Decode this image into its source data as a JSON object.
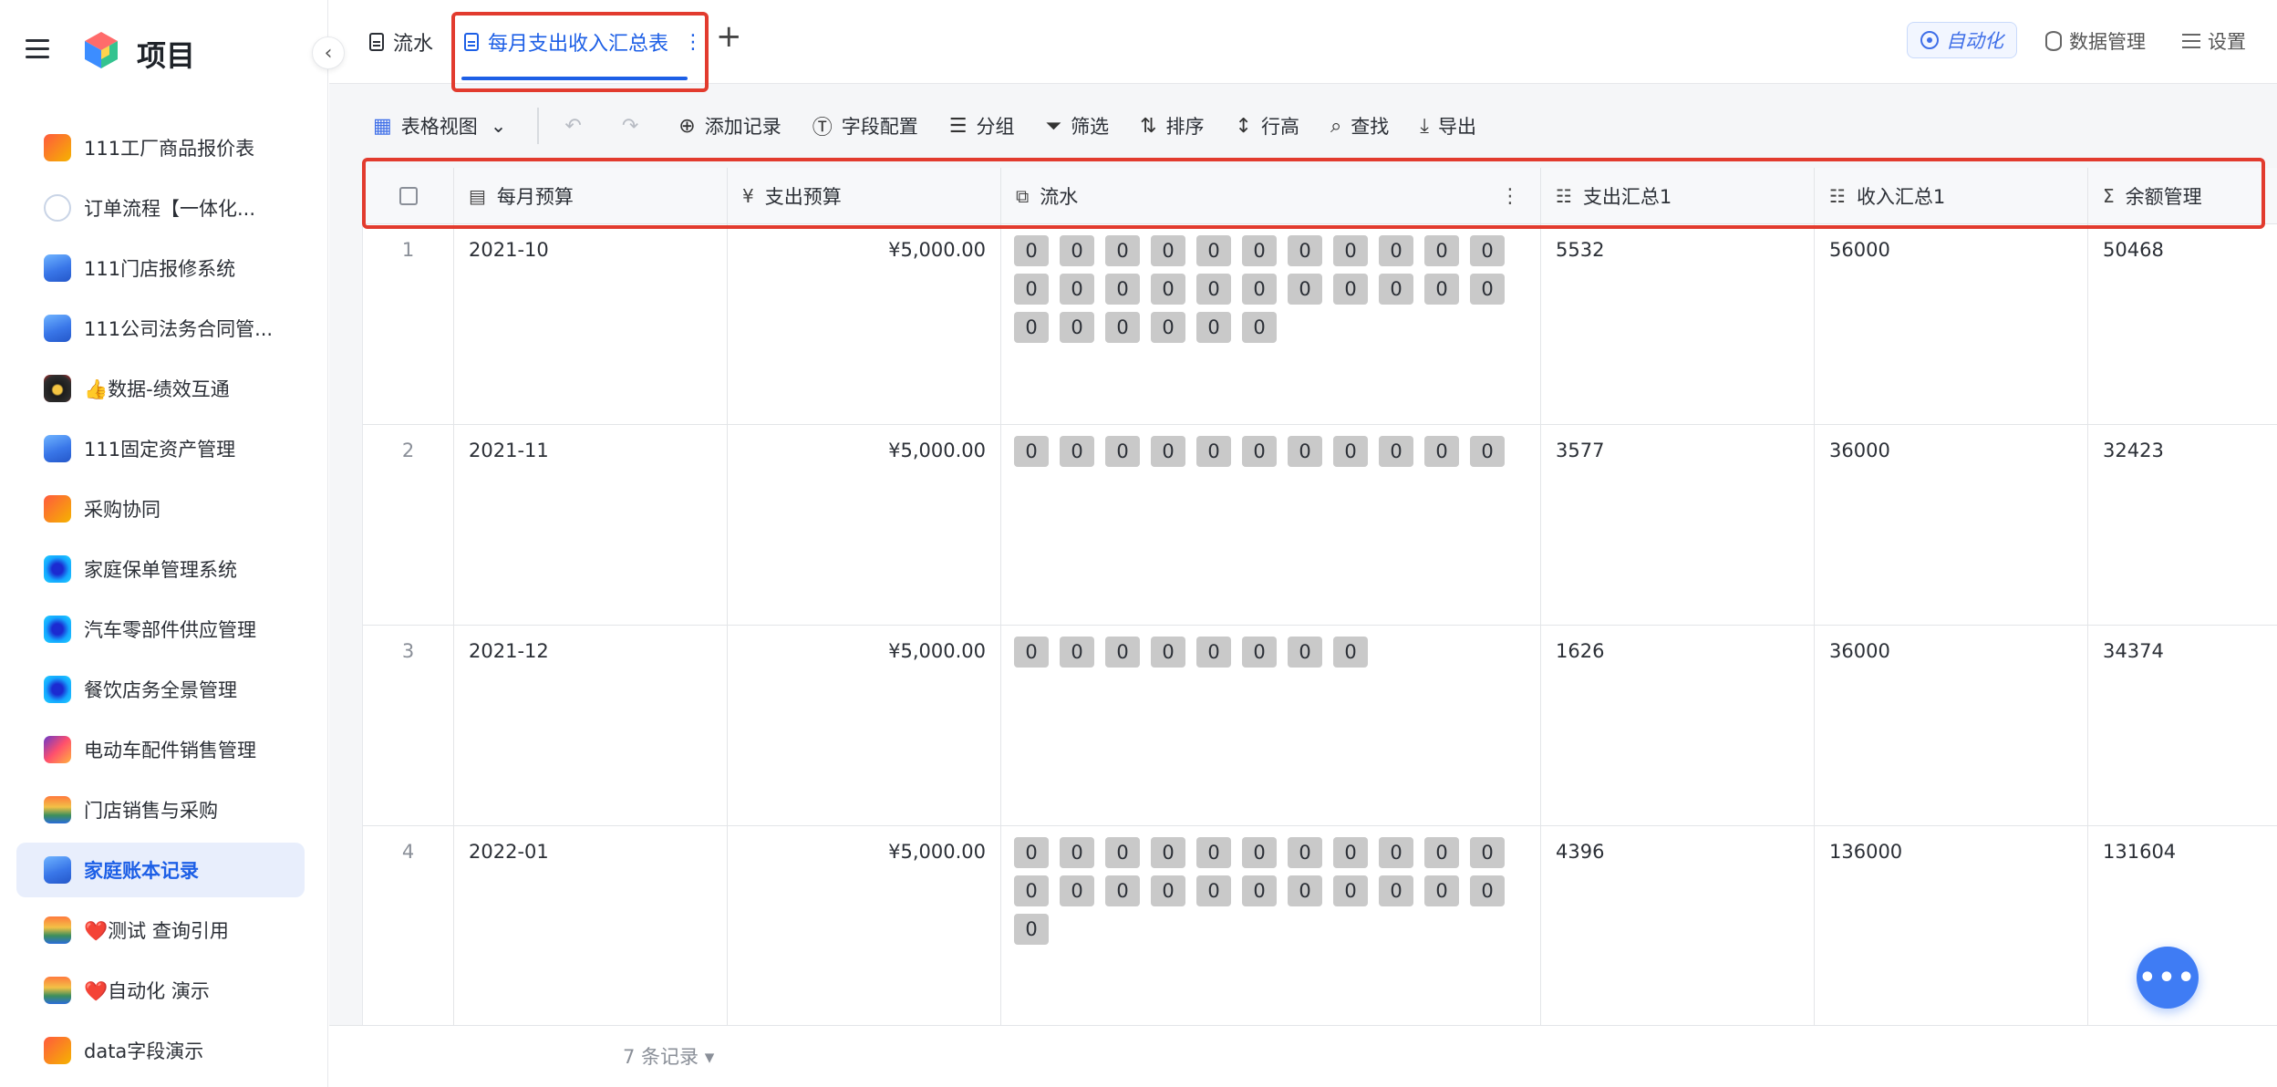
{
  "sidebar": {
    "title": "项目",
    "items": [
      {
        "label": "111工厂商品报价表",
        "icon": "red-app-icon"
      },
      {
        "label": "订单流程【一体化...",
        "icon": "circle-app-icon"
      },
      {
        "label": "111门店报修系统",
        "icon": "blue-app-icon"
      },
      {
        "label": "111公司法务合同管...",
        "icon": "blue-app-icon"
      },
      {
        "label": "👍数据-绩效互通",
        "icon": "dark-app-icon"
      },
      {
        "label": "111固定资产管理",
        "icon": "blue-app-icon"
      },
      {
        "label": "采购协同",
        "icon": "red-app-icon"
      },
      {
        "label": "家庭保单管理系统",
        "icon": "cyan-app-icon"
      },
      {
        "label": "汽车零部件供应管理",
        "icon": "cyan-app-icon"
      },
      {
        "label": "餐饮店务全景管理",
        "icon": "cyan-app-icon"
      },
      {
        "label": "电动车配件销售管理",
        "icon": "multi-app-icon"
      },
      {
        "label": "门店销售与采购",
        "icon": "land-app-icon"
      },
      {
        "label": "家庭账本记录",
        "icon": "blue-app-icon",
        "active": true
      },
      {
        "label": "❤️测试 查询引用",
        "icon": "land-app-icon"
      },
      {
        "label": "❤️自动化 演示",
        "icon": "land-app-icon"
      },
      {
        "label": "data字段演示",
        "icon": "red-app-icon"
      }
    ]
  },
  "tabs": [
    {
      "label": "流水"
    },
    {
      "label": "每月支出收入汇总表",
      "active": true
    }
  ],
  "top_actions": {
    "automation": "自动化",
    "data_management": "数据管理",
    "settings": "设置"
  },
  "toolbar": {
    "view": "表格视图",
    "add_record": "添加记录",
    "field_config": "字段配置",
    "group": "分组",
    "filter": "筛选",
    "sort": "排序",
    "row_height": "行高",
    "find": "查找",
    "export": "导出"
  },
  "columns": {
    "month_budget": "每月预算",
    "expense_budget": "支出预算",
    "flow": "流水",
    "expense_total": "支出汇总1",
    "income_total": "收入汇总1",
    "balance": "余额管理"
  },
  "rows": [
    {
      "num": "1",
      "month": "2021-10",
      "budget": "¥5,000.00",
      "chips": [
        "0",
        "0",
        "0",
        "0",
        "0",
        "0",
        "0",
        "0",
        "0",
        "0",
        "0",
        "0",
        "0",
        "0",
        "0",
        "0",
        "0",
        "0",
        "0",
        "0",
        "0",
        "0",
        "0",
        "0",
        "0",
        "0",
        "0",
        "0"
      ],
      "expense": "5532",
      "income": "56000",
      "balance": "50468"
    },
    {
      "num": "2",
      "month": "2021-11",
      "budget": "¥5,000.00",
      "chips": [
        "0",
        "0",
        "0",
        "0",
        "0",
        "0",
        "0",
        "0",
        "0",
        "0",
        "0"
      ],
      "expense": "3577",
      "income": "36000",
      "balance": "32423"
    },
    {
      "num": "3",
      "month": "2021-12",
      "budget": "¥5,000.00",
      "chips": [
        "0",
        "0",
        "0",
        "0",
        "0",
        "0",
        "0",
        "0"
      ],
      "expense": "1626",
      "income": "36000",
      "balance": "34374"
    },
    {
      "num": "4",
      "month": "2022-01",
      "budget": "¥5,000.00",
      "chips": [
        "0",
        "0",
        "0",
        "0",
        "0",
        "0",
        "0",
        "0",
        "0",
        "0",
        "0",
        "0",
        "0",
        "0",
        "0",
        "0",
        "0",
        "0",
        "0",
        "0",
        "0",
        "0",
        "0"
      ],
      "expense": "4396",
      "income": "136000",
      "balance": "131604"
    }
  ],
  "footer": {
    "count": "7 条记录"
  },
  "fab": {
    "label": "•••"
  }
}
